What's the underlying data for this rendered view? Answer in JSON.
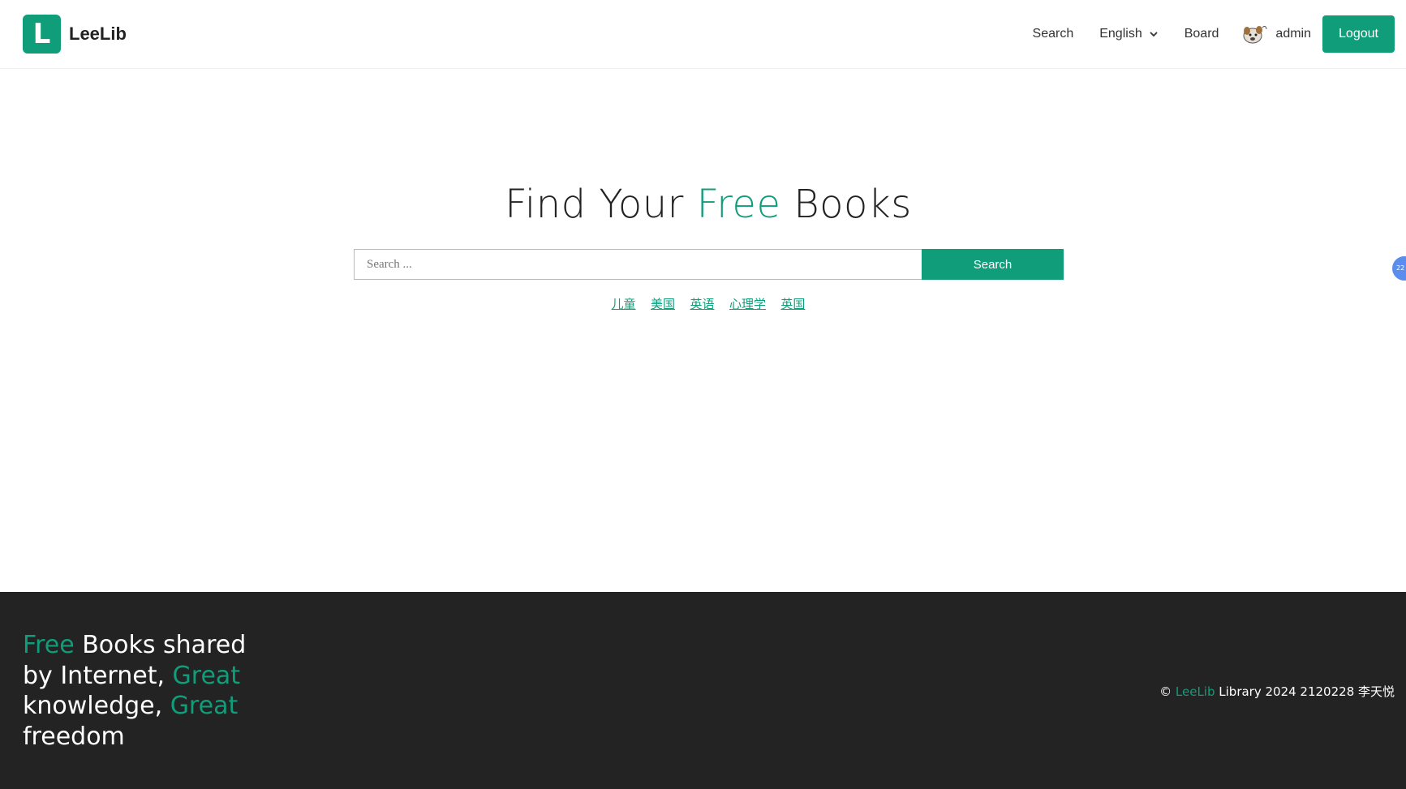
{
  "brand": {
    "logo_letter": "L",
    "name": "LeeLib"
  },
  "nav": {
    "search_label": "Search",
    "language_label": "English",
    "board_label": "Board",
    "username": "admin",
    "logout_label": "Logout"
  },
  "hero": {
    "title_before": "Find Your ",
    "title_accent": "Free",
    "title_after": " Books",
    "search_placeholder": "Search ...",
    "search_button": "Search",
    "tags": [
      "儿童",
      "美国",
      "英语",
      "心理学",
      "英国"
    ]
  },
  "float_badge": {
    "text": "22"
  },
  "footer": {
    "slogan": {
      "free": "Free",
      "text1": " Books shared by Internet, ",
      "great1": "Great",
      "text2": " knowledge, ",
      "great2": "Great",
      "text3": " freedom"
    },
    "copyright": {
      "symbol": "© ",
      "brand": "LeeLib",
      "rest": " Library 2024 2120228 李天悦"
    }
  },
  "colors": {
    "accent": "#0f9d7a",
    "footer_bg": "#232323",
    "text": "#222222"
  }
}
